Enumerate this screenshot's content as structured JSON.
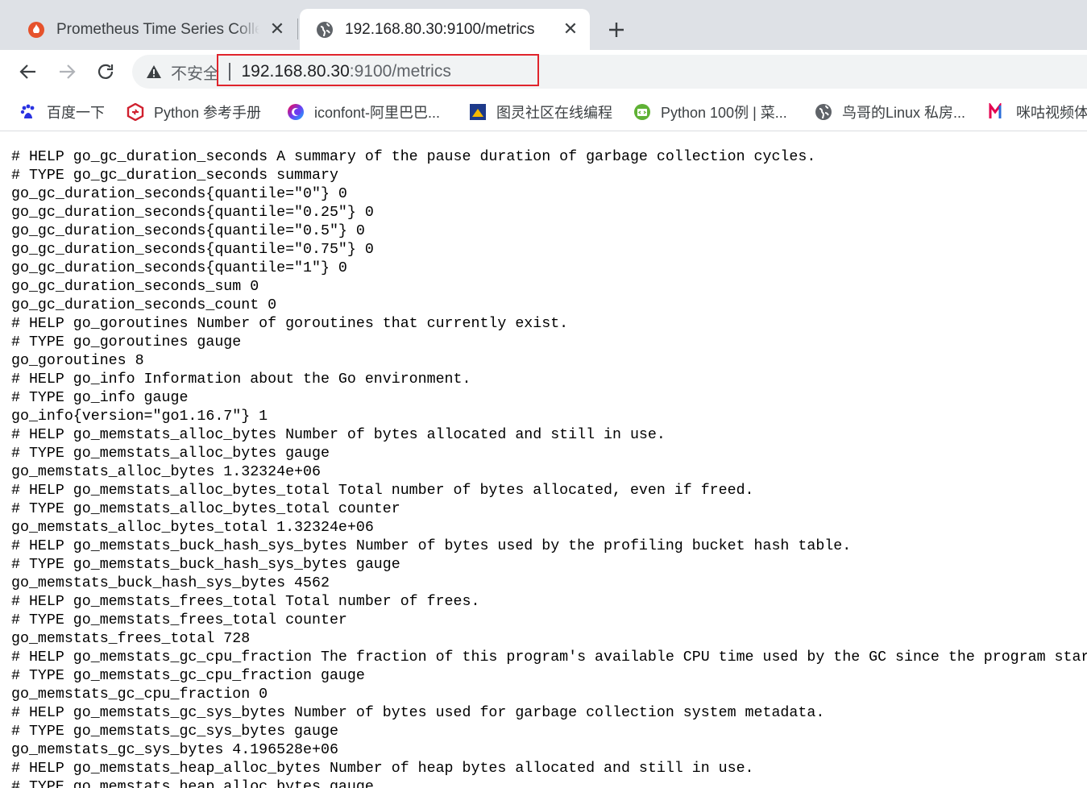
{
  "tabs": [
    {
      "title": "Prometheus Time Series Collec",
      "active": false,
      "icon": "prometheus-icon"
    },
    {
      "title": "192.168.80.30:9100/metrics",
      "active": true,
      "icon": "globe-icon"
    }
  ],
  "toolbar": {
    "security_label": "不安全",
    "url_host": "192.168.80.30",
    "url_rest": ":9100/metrics"
  },
  "bookmarks": [
    {
      "label": "百度一下",
      "icon": "baidu-paw-icon",
      "color": "#2932e1"
    },
    {
      "label": "Python 参考手册",
      "icon": "python-doc-icon",
      "color": "#d0202e"
    },
    {
      "label": "iconfont-阿里巴巴...",
      "icon": "iconfont-icon",
      "color": "#6c3cf0"
    },
    {
      "label": "图灵社区在线编程",
      "icon": "turing-icon",
      "color": "#1d3a8a"
    },
    {
      "label": "Python 100例 | 菜...",
      "icon": "runoob-icon",
      "color": "#5fb135"
    },
    {
      "label": "鸟哥的Linux 私房...",
      "icon": "globe-icon",
      "color": "#5f6368"
    },
    {
      "label": "咪咕视频体",
      "icon": "migu-icon",
      "color": "#e4004f"
    }
  ],
  "metrics_lines": [
    "# HELP go_gc_duration_seconds A summary of the pause duration of garbage collection cycles.",
    "# TYPE go_gc_duration_seconds summary",
    "go_gc_duration_seconds{quantile=\"0\"} 0",
    "go_gc_duration_seconds{quantile=\"0.25\"} 0",
    "go_gc_duration_seconds{quantile=\"0.5\"} 0",
    "go_gc_duration_seconds{quantile=\"0.75\"} 0",
    "go_gc_duration_seconds{quantile=\"1\"} 0",
    "go_gc_duration_seconds_sum 0",
    "go_gc_duration_seconds_count 0",
    "# HELP go_goroutines Number of goroutines that currently exist.",
    "# TYPE go_goroutines gauge",
    "go_goroutines 8",
    "# HELP go_info Information about the Go environment.",
    "# TYPE go_info gauge",
    "go_info{version=\"go1.16.7\"} 1",
    "# HELP go_memstats_alloc_bytes Number of bytes allocated and still in use.",
    "# TYPE go_memstats_alloc_bytes gauge",
    "go_memstats_alloc_bytes 1.32324e+06",
    "# HELP go_memstats_alloc_bytes_total Total number of bytes allocated, even if freed.",
    "# TYPE go_memstats_alloc_bytes_total counter",
    "go_memstats_alloc_bytes_total 1.32324e+06",
    "# HELP go_memstats_buck_hash_sys_bytes Number of bytes used by the profiling bucket hash table.",
    "# TYPE go_memstats_buck_hash_sys_bytes gauge",
    "go_memstats_buck_hash_sys_bytes 4562",
    "# HELP go_memstats_frees_total Total number of frees.",
    "# TYPE go_memstats_frees_total counter",
    "go_memstats_frees_total 728",
    "# HELP go_memstats_gc_cpu_fraction The fraction of this program's available CPU time used by the GC since the program started.",
    "# TYPE go_memstats_gc_cpu_fraction gauge",
    "go_memstats_gc_cpu_fraction 0",
    "# HELP go_memstats_gc_sys_bytes Number of bytes used for garbage collection system metadata.",
    "# TYPE go_memstats_gc_sys_bytes gauge",
    "go_memstats_gc_sys_bytes 4.196528e+06",
    "# HELP go_memstats_heap_alloc_bytes Number of heap bytes allocated and still in use.",
    "# TYPE go_memstats_heap_alloc_bytes gauge"
  ]
}
